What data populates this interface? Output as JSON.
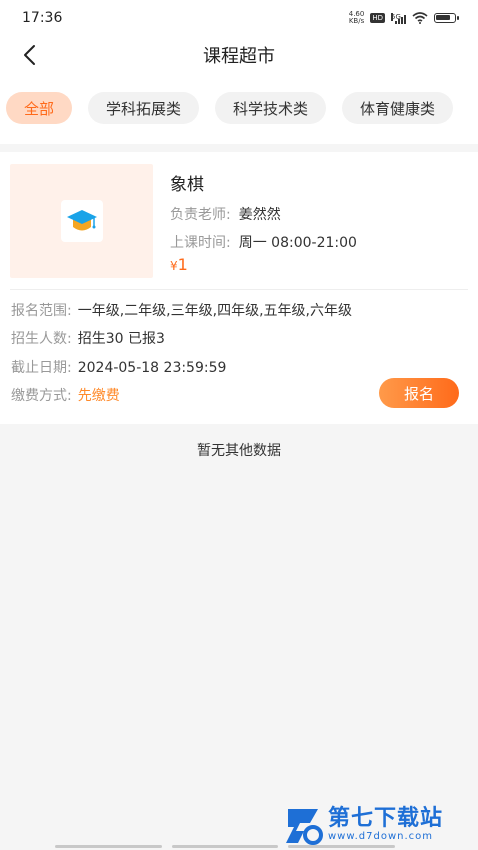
{
  "status_bar": {
    "time": "17:36",
    "net_speed_value": "4.60",
    "net_speed_unit": "KB/s",
    "hd_label": "HD",
    "signal_label": "5G",
    "icons": [
      "hd-icon",
      "signal-icon",
      "wifi-icon",
      "battery-icon"
    ]
  },
  "nav": {
    "title": "课程超市",
    "back_icon": "chevron-left-icon"
  },
  "tabs": [
    {
      "label": "全部",
      "active": true
    },
    {
      "label": "学科拓展类",
      "active": false
    },
    {
      "label": "科学技术类",
      "active": false
    },
    {
      "label": "体育健康类",
      "active": false
    }
  ],
  "course": {
    "thumbnail_icon": "graduation-cap-icon",
    "name": "象棋",
    "teacher_label": "负责老师:",
    "teacher": "姜然然",
    "time_label": "上课时间:",
    "time": "周一 08:00-21:00",
    "currency": "¥",
    "price": "1",
    "scope_label": "报名范围:",
    "scope": "一年级,二年级,三年级,四年级,五年级,六年级",
    "enroll_label": "招生人数:",
    "enroll": "招生30 已报3",
    "deadline_label": "截止日期:",
    "deadline": "2024-05-18 23:59:59",
    "payment_label": "缴费方式:",
    "payment": "先缴费",
    "signup_label": "报名"
  },
  "empty_text": "暂无其他数据",
  "watermark": {
    "name": "第七下载站",
    "url": "www.d7down.com"
  },
  "colors": {
    "accent": "#ff6a1a",
    "tab_active_bg": "#ffd9c4",
    "watermark_blue": "#1e6fd6"
  }
}
